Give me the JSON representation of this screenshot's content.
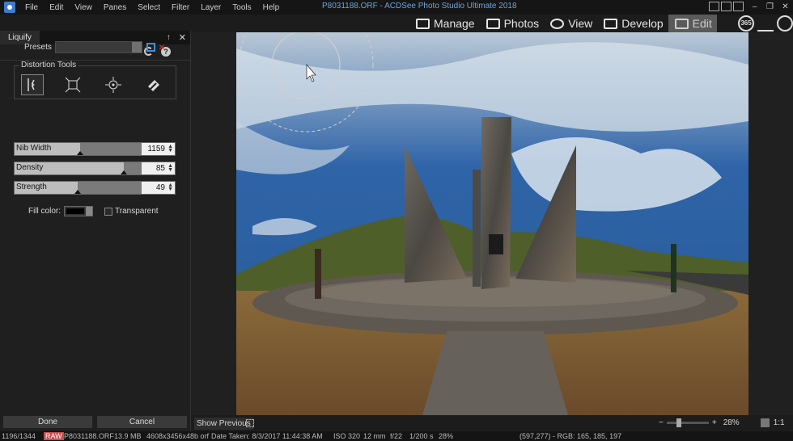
{
  "titlebar": {
    "menu": [
      "File",
      "Edit",
      "View",
      "Panes",
      "Select",
      "Filter",
      "Layer",
      "Tools",
      "Help"
    ],
    "title": "P8031188.ORF - ACDSee Photo Studio Ultimate 2018",
    "min": "–",
    "restore": "❐",
    "close": "✕"
  },
  "modes": {
    "manage": "Manage",
    "photos": "Photos",
    "view": "View",
    "develop": "Develop",
    "edit": "Edit",
    "badge_365": "365"
  },
  "panel": {
    "tab": "Liquify",
    "pin": "↑",
    "close": "✕",
    "help": "?",
    "presets_label": "Presets",
    "presets_value": "",
    "distortion_label": "Distortion Tools",
    "sliders": [
      {
        "label": "Nib Width",
        "value": "1159",
        "fraction": 0.51
      },
      {
        "label": "Density",
        "value": "85",
        "fraction": 0.85
      },
      {
        "label": "Strength",
        "value": "49",
        "fraction": 0.49
      }
    ],
    "fill_color_label": "Fill color:",
    "transparent_label": "Transparent",
    "done": "Done",
    "cancel": "Cancel"
  },
  "bottom": {
    "show_previous": "Show Previous",
    "zoom_minus": "−",
    "zoom_plus": "+",
    "zoom_value": "28%",
    "zoom_level": 0.28,
    "one_to_one": "1:1"
  },
  "status": {
    "index": "1196/1344",
    "raw": "RAW",
    "filename": "P8031188.ORF",
    "size": "13.9 MB",
    "dims": "4608x3456x48b orf",
    "date": "Date Taken: 8/3/2017 11:44:38 AM",
    "iso": "ISO 320",
    "focal": "12 mm",
    "aperture": "f/22",
    "shutter": "1/200 s",
    "zoom": "28%",
    "pixel": "(597,277) - RGB: 165, 185, 197"
  },
  "colors": {
    "accent_blue": "#3f8fd8",
    "title_blue": "#6ea4dd",
    "delete_red": "#dd3333"
  }
}
